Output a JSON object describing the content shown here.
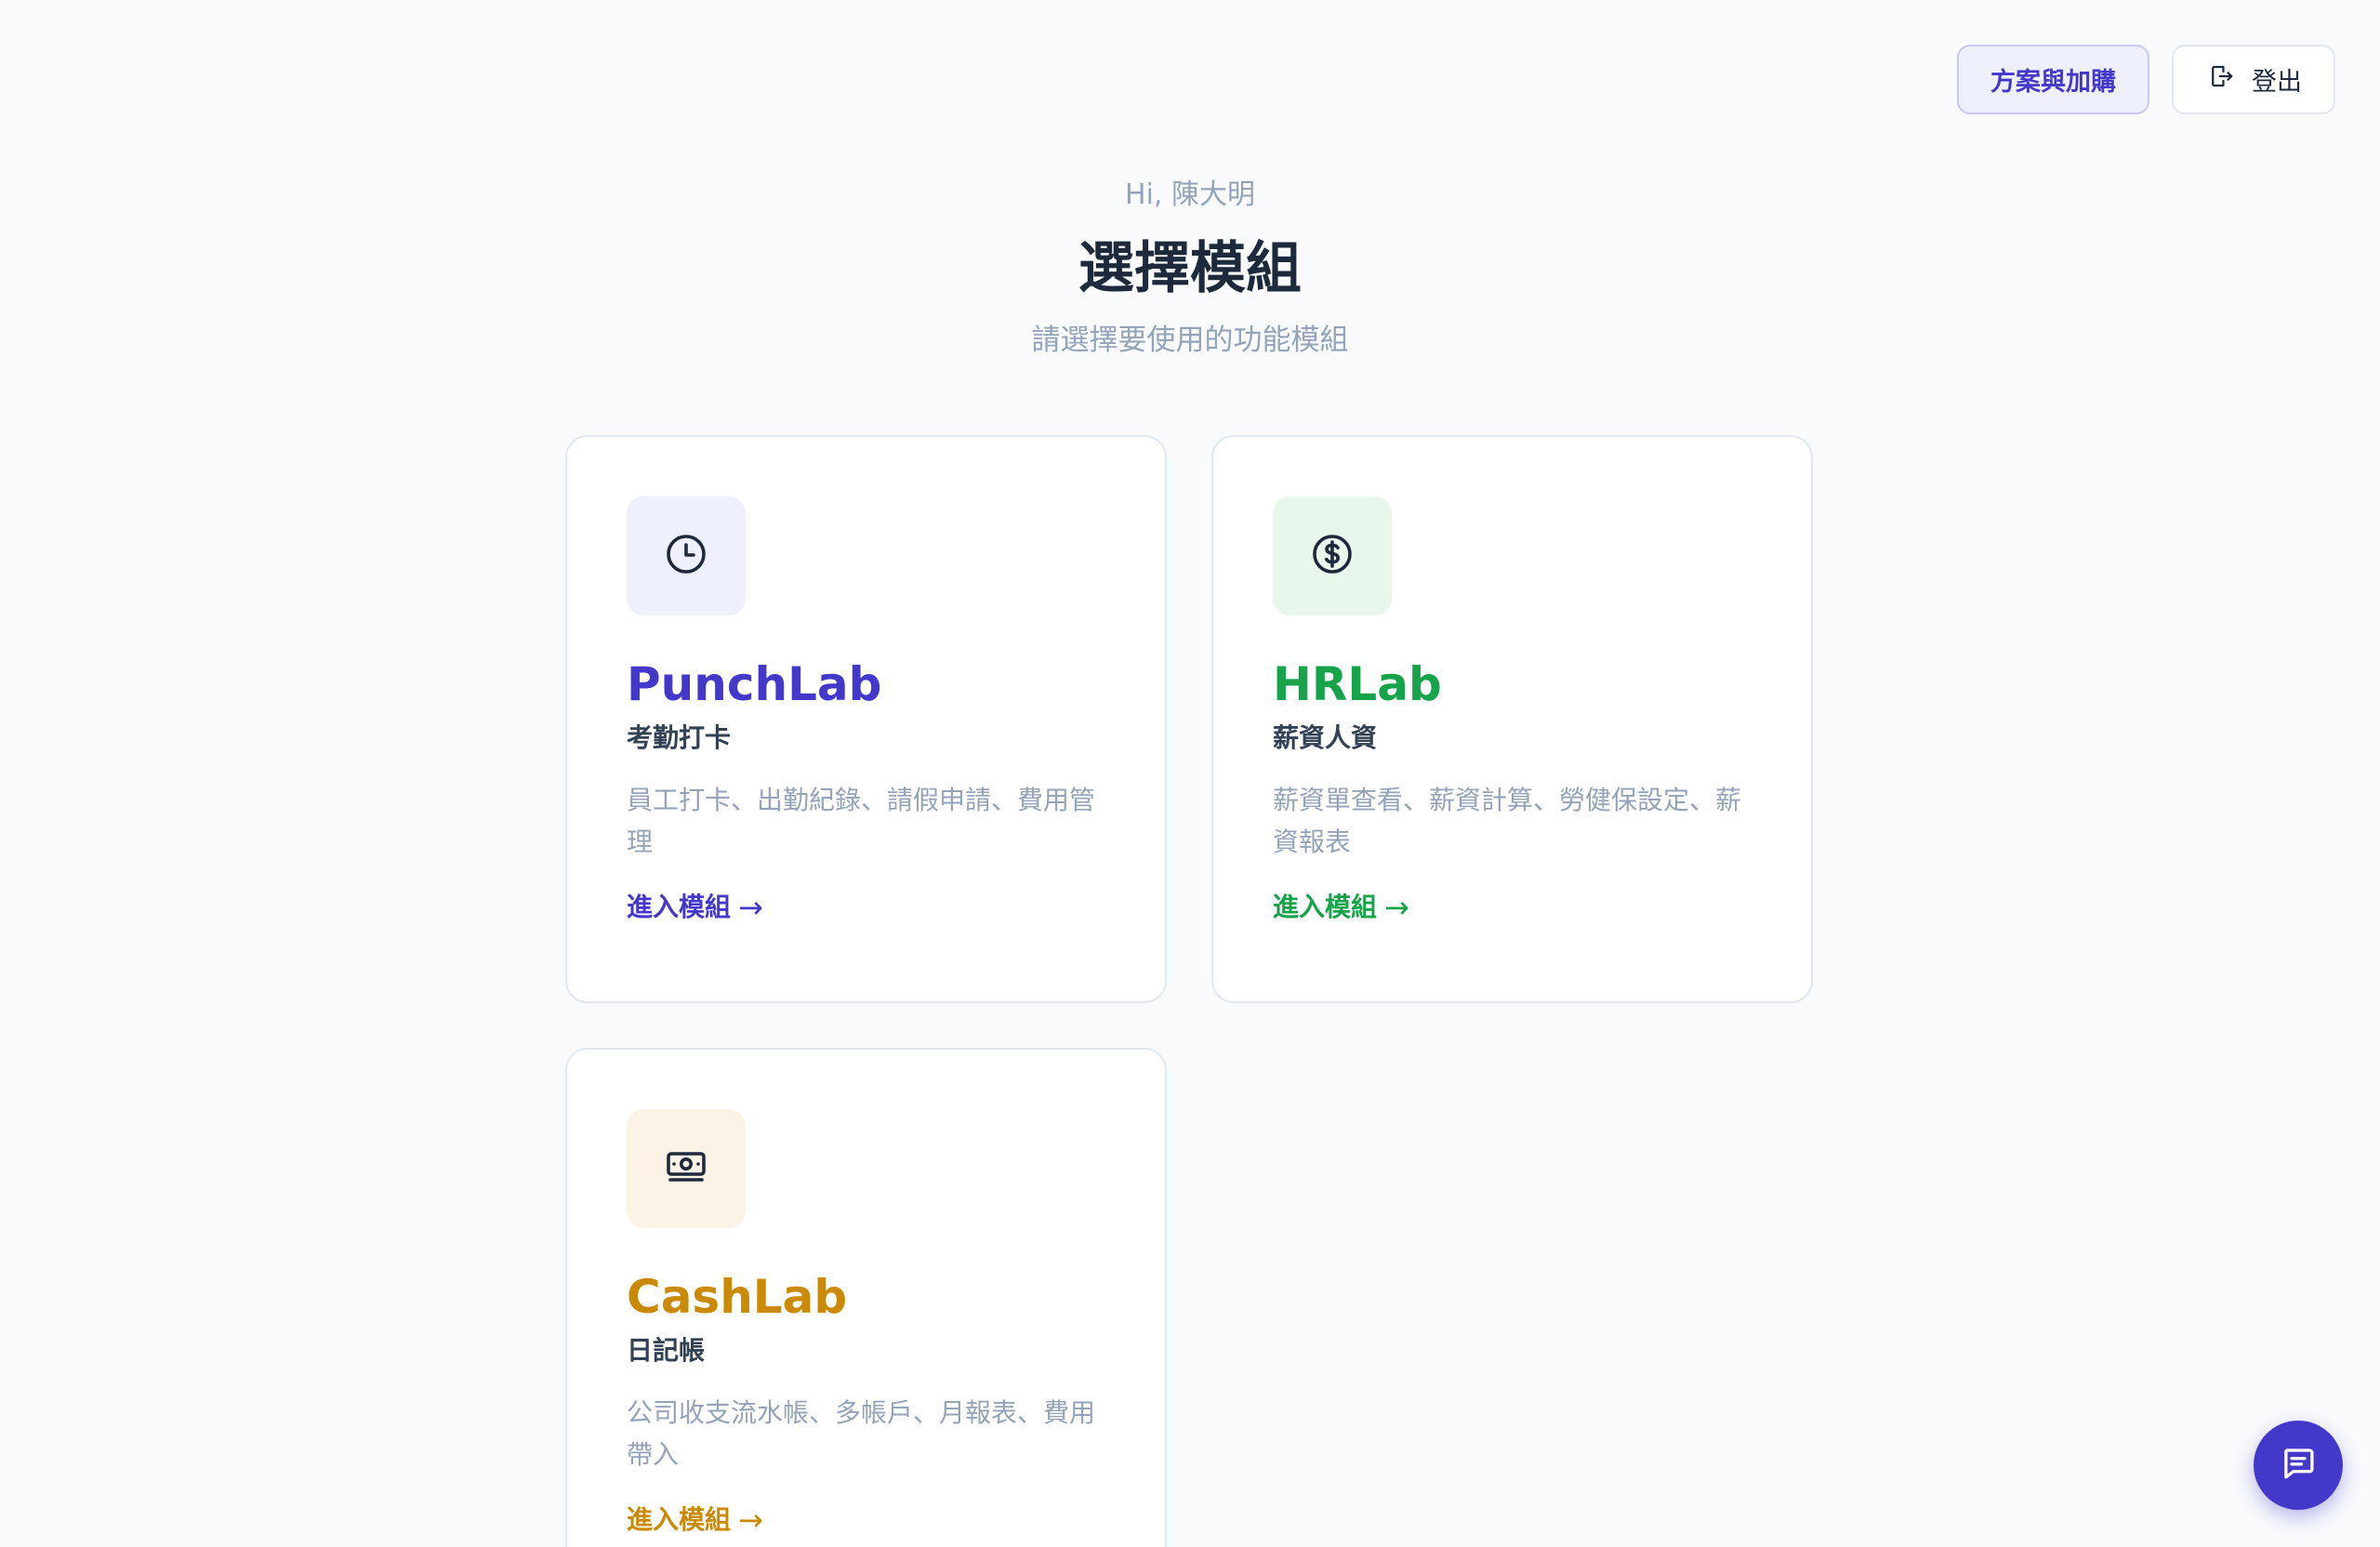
{
  "actions": {
    "plan_label": "方案與加購",
    "logout_label": "登出",
    "logout_icon": "logout-icon"
  },
  "header": {
    "greeting": "Hi, 陳大明",
    "title": "選擇模組",
    "subtitle": "請選擇要使用的功能模組"
  },
  "modules": [
    {
      "id": "punchlab",
      "icon": "clock-icon",
      "name": "PunchLab",
      "subtitle": "考勤打卡",
      "description": "員工打卡、出勤紀錄、請假申請、費用管理",
      "link_label": "進入模組",
      "arrow": "→",
      "accent": "#4338ca",
      "icon_bg": "#eef0fd"
    },
    {
      "id": "hrlab",
      "icon": "dollar-circle-icon",
      "name": "HRLab",
      "subtitle": "薪資人資",
      "description": "薪資單查看、薪資計算、勞健保設定、薪資報表",
      "link_label": "進入模組",
      "arrow": "→",
      "accent": "#16a34a",
      "icon_bg": "#e8f6ec"
    },
    {
      "id": "cashlab",
      "icon": "banknote-icon",
      "name": "CashLab",
      "subtitle": "日記帳",
      "description": "公司收支流水帳、多帳戶、月報表、費用帶入",
      "link_label": "進入模組",
      "arrow": "→",
      "accent": "#ca8a04",
      "icon_bg": "#fbf3e6"
    }
  ],
  "chat": {
    "icon": "chat-icon",
    "color": "#4338ca"
  }
}
